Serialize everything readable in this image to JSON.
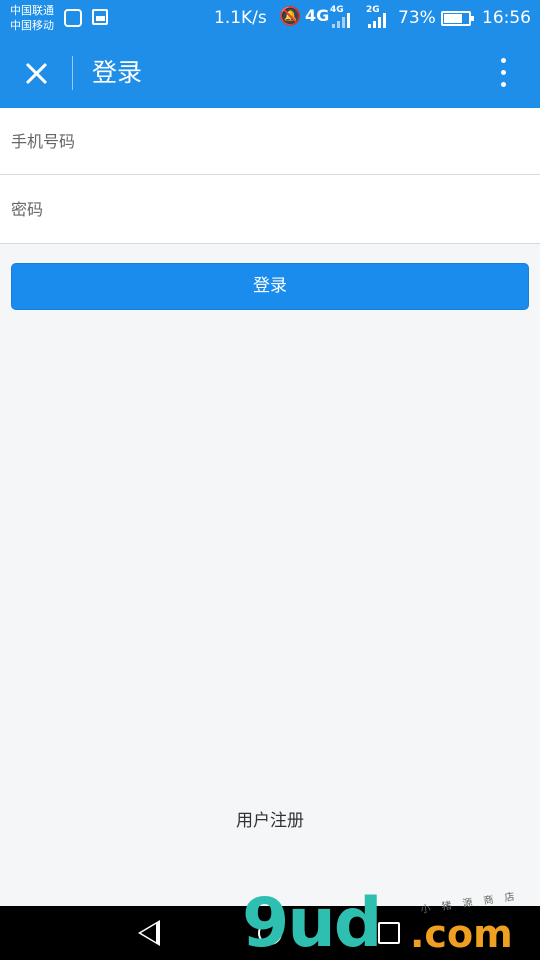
{
  "status_bar": {
    "carrier_1": "中国联通",
    "carrier_2": "中国移动",
    "net_speed": "1.1K/s",
    "net_type_1": "4G",
    "net_type_1_small": "4G",
    "net_type_2": "2G",
    "battery_percent": "73%",
    "battery_level": 0.73,
    "time": "16:56"
  },
  "app_bar": {
    "title": "登录",
    "close_icon": "close-icon",
    "more_icon": "more-vert-icon"
  },
  "form": {
    "phone_placeholder": "手机号码",
    "phone_value": "",
    "password_placeholder": "密码",
    "password_value": "",
    "login_label": "登录"
  },
  "footer": {
    "register_label": "用户注册"
  },
  "nav_bar": {
    "back_icon": "back-triangle-icon",
    "home_icon": "home-circle-icon",
    "recent_icon": "recent-square-icon"
  },
  "watermark": {
    "logo": "9",
    "logo_rest": "ud",
    "domain": ".com",
    "sub": "小 猪 源 商 店"
  },
  "colors": {
    "primary": "#1e8ee9",
    "button": "#1a8cee",
    "background": "#f4f6f7"
  }
}
